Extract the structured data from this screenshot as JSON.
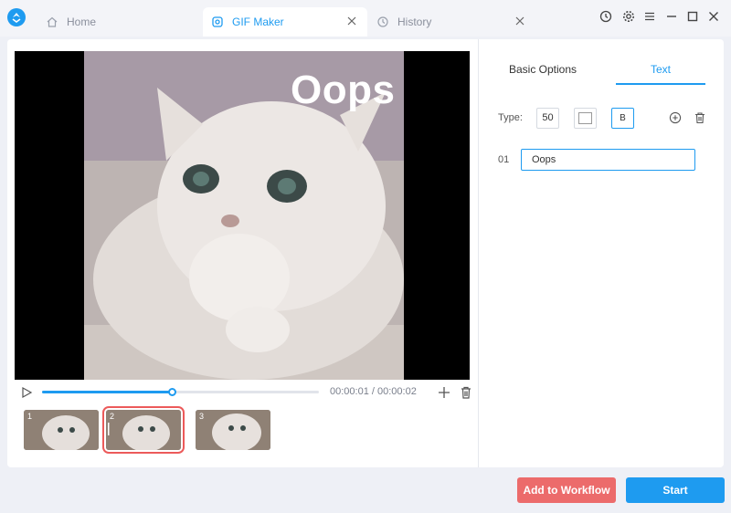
{
  "tabs": [
    {
      "label": "Home",
      "icon": "home-icon"
    },
    {
      "label": "GIF Maker",
      "icon": "gif-maker-icon",
      "active": true
    },
    {
      "label": "History",
      "icon": "history-icon"
    }
  ],
  "window_controls": [
    "clock-icon",
    "gear-icon",
    "menu-icon",
    "minimize-icon",
    "maximize-icon",
    "close-icon"
  ],
  "colors": {
    "accent": "#1e9bf0",
    "danger": "#ec6b6b",
    "selection": "#ec5a5a"
  },
  "preview": {
    "overlay_text": "Oops"
  },
  "player": {
    "time": "00:00:01 / 00:00:02",
    "progress": 0.47
  },
  "frames": [
    {
      "num": "1",
      "selected": false
    },
    {
      "num": "2",
      "selected": true
    },
    {
      "num": "3",
      "selected": false
    }
  ],
  "right": {
    "tabs": {
      "basic": "Basic Options",
      "text": "Text"
    },
    "type_label": "Type:",
    "font_size": "50",
    "font_color": "#ffffff",
    "bold_label": "B",
    "text_rows": [
      {
        "num": "01",
        "value": "Oops"
      }
    ]
  },
  "buttons": {
    "workflow": "Add to Workflow",
    "start": "Start"
  }
}
